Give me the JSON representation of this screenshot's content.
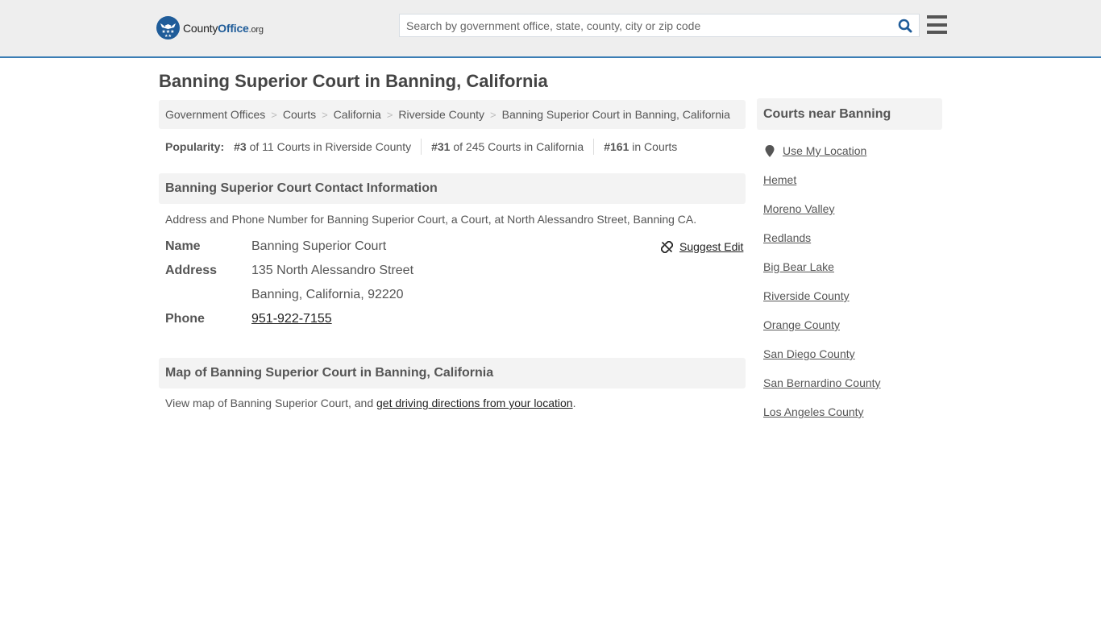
{
  "header": {
    "logo": {
      "brand_county": "County",
      "brand_office": "Office",
      "brand_tld": ".org",
      "icon": "eagle-stars-badge-icon"
    },
    "search": {
      "placeholder": "Search by government office, state, county, city or zip code",
      "value": "",
      "icon": "search-icon"
    },
    "menu_icon": "hamburger-menu-icon",
    "colors": {
      "accent": "#3a7db4",
      "brand_blue": "#1f5c99",
      "header_bg": "#eeeeee"
    }
  },
  "page": {
    "title": "Banning Superior Court in Banning, California",
    "breadcrumb": [
      {
        "label": "Government Offices"
      },
      {
        "label": "Courts"
      },
      {
        "label": "California"
      },
      {
        "label": "Riverside County"
      },
      {
        "label": "Banning Superior Court in Banning, California"
      }
    ],
    "breadcrumb_separator": ">",
    "popularity": {
      "label": "Popularity:",
      "items": [
        {
          "rank": "#3",
          "text": " of 11 Courts in Riverside County"
        },
        {
          "rank": "#31",
          "text": " of 245 Courts in California"
        },
        {
          "rank": "#161",
          "text": " in Courts"
        }
      ]
    }
  },
  "contact": {
    "heading": "Banning Superior Court Contact Information",
    "description": "Address and Phone Number for Banning Superior Court, a Court, at North Alessandro Street, Banning CA.",
    "suggest_edit": {
      "label": "Suggest Edit",
      "icon": "broken-link-icon"
    },
    "fields": {
      "name_label": "Name",
      "name_value": "Banning Superior Court",
      "address_label": "Address",
      "address_line1": "135 North Alessandro Street",
      "address_line2": "Banning, California, 92220",
      "phone_label": "Phone",
      "phone_value": "951-922-7155"
    }
  },
  "map": {
    "heading": "Map of Banning Superior Court in Banning, California",
    "description_prefix": "View map of Banning Superior Court, and ",
    "directions_link": "get driving directions from your location",
    "description_suffix": "."
  },
  "sidebar": {
    "heading": "Courts near Banning",
    "use_location": {
      "label": "Use My Location",
      "icon": "map-pin-icon"
    },
    "links": [
      {
        "label": "Hemet"
      },
      {
        "label": "Moreno Valley"
      },
      {
        "label": "Redlands"
      },
      {
        "label": "Big Bear Lake"
      },
      {
        "label": "Riverside County"
      },
      {
        "label": "Orange County"
      },
      {
        "label": "San Diego County"
      },
      {
        "label": "San Bernardino County"
      },
      {
        "label": "Los Angeles County"
      }
    ]
  }
}
